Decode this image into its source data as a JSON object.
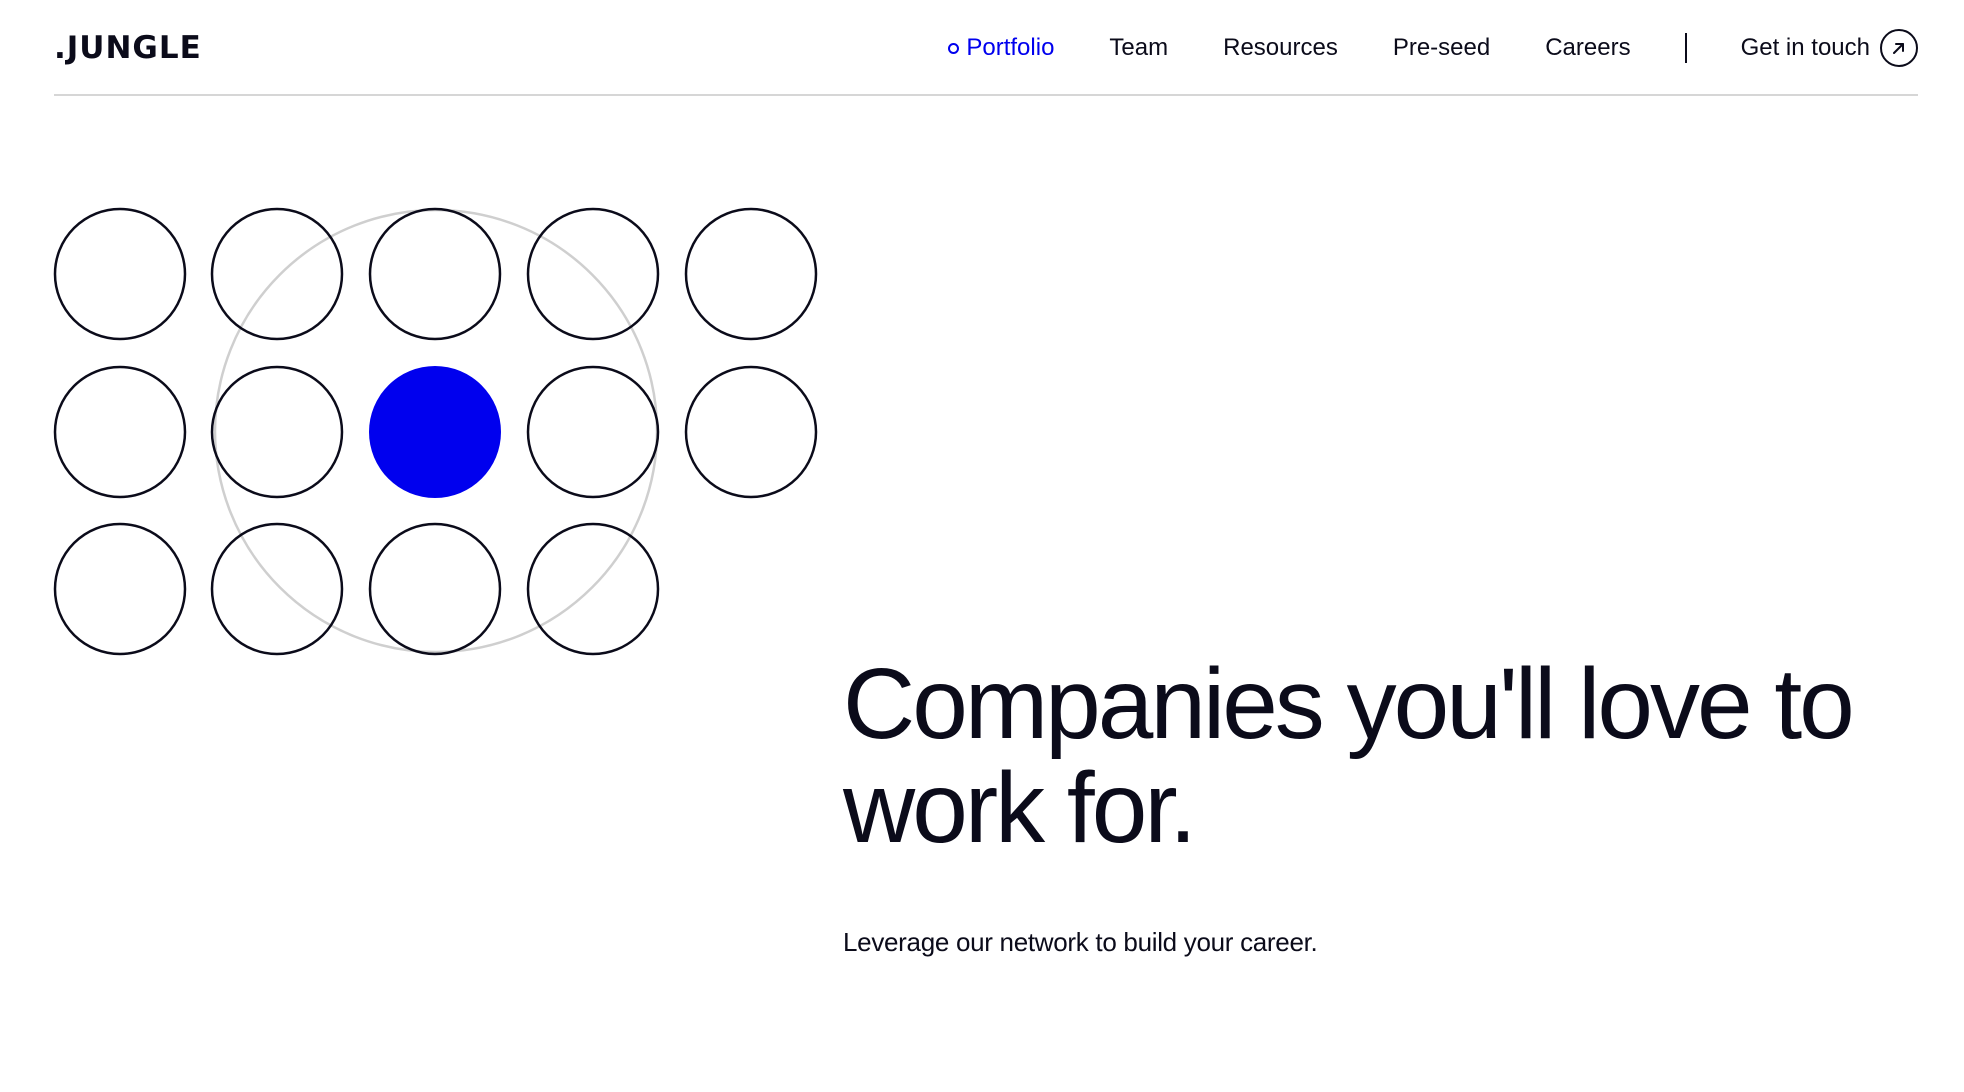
{
  "header": {
    "logo_text": ".JUNGLE",
    "nav": [
      {
        "label": "Portfolio",
        "active": true
      },
      {
        "label": "Team"
      },
      {
        "label": "Resources"
      },
      {
        "label": "Pre-seed"
      },
      {
        "label": "Careers"
      }
    ],
    "cta_label": "Get in touch",
    "cta_icon": "arrow-up-right-icon"
  },
  "hero": {
    "title": "Companies you'll love to work for.",
    "subtitle": "Leverage our network to build your career."
  },
  "colors": {
    "accent": "#0000ee",
    "text": "#0b0b1a",
    "divider": "#d6d6d6",
    "ring": "#cfcfcf"
  },
  "graphic": {
    "rows": 3,
    "columns": 5,
    "circle_count": 14,
    "filled_circle": {
      "row": 2,
      "column": 3
    }
  }
}
